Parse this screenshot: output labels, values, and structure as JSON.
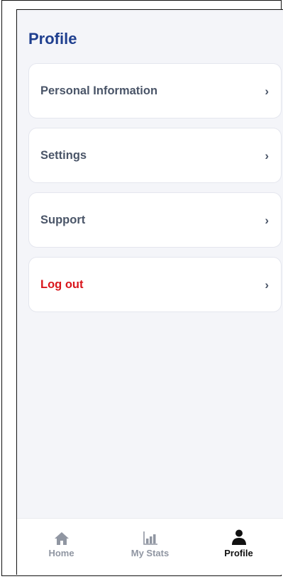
{
  "header": {
    "title": "Profile"
  },
  "menu": {
    "items": [
      {
        "label": "Personal Information",
        "chevron": "›",
        "icon": "chevron-right-icon"
      },
      {
        "label": "Settings",
        "chevron": "›",
        "icon": "chevron-right-icon"
      },
      {
        "label": "Support",
        "chevron": "›",
        "icon": "chevron-right-icon"
      },
      {
        "label": "Log out",
        "chevron": "›",
        "icon": "chevron-right-icon",
        "color": "#d9161c"
      }
    ]
  },
  "tabbar": {
    "active": "Profile",
    "tabs": [
      {
        "label": "Home",
        "icon": "home-icon"
      },
      {
        "label": "My Stats",
        "icon": "bar-chart-icon"
      },
      {
        "label": "Profile",
        "icon": "person-icon"
      }
    ]
  },
  "colors": {
    "title": "#1f3f8f",
    "danger": "#d9161c",
    "background": "#f4f5f9",
    "inactive_tab": "#9096a2",
    "active_tab": "#111111"
  }
}
